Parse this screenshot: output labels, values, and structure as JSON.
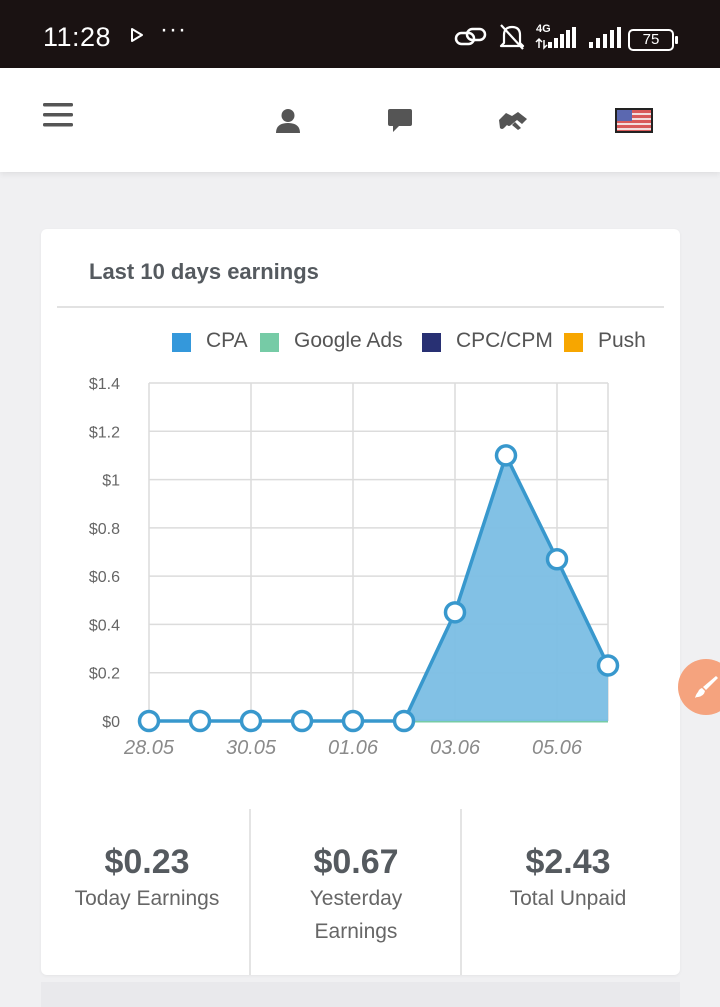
{
  "status_bar": {
    "time": "11:28",
    "network": "4G",
    "battery": "75"
  },
  "nav": {
    "icons": [
      "menu-icon",
      "user-icon",
      "chat-icon",
      "handshake-icon",
      "us-flag-icon"
    ]
  },
  "card": {
    "title": "Last 10 days earnings"
  },
  "chart_data": {
    "type": "area",
    "title": "Last 10 days earnings",
    "legend_position": "top-right",
    "grid": true,
    "x_dates": [
      "28.05",
      "29.05",
      "30.05",
      "31.05",
      "01.06",
      "02.06",
      "03.06",
      "04.06",
      "05.06",
      "06.06"
    ],
    "x_tick_labels": [
      "28.05",
      "30.05",
      "01.06",
      "03.06",
      "05.06"
    ],
    "y_tick_labels": [
      "$0",
      "$0.2",
      "$0.4",
      "$0.6",
      "$0.8",
      "$1",
      "$1.2",
      "$1.4"
    ],
    "ylim": [
      0,
      1.4
    ],
    "series": [
      {
        "name": "CPA",
        "color": "#3498db",
        "values": [
          0,
          0,
          0,
          0,
          0,
          0,
          0.45,
          1.1,
          0.67,
          0.23
        ]
      },
      {
        "name": "Google Ads",
        "color": "#76cba6",
        "values": [
          0,
          0,
          0,
          0,
          0,
          0,
          0,
          0,
          0,
          0
        ]
      },
      {
        "name": "CPC/CPM",
        "color": "#283073",
        "values": []
      },
      {
        "name": "Push",
        "color": "#f7a600",
        "values": []
      }
    ]
  },
  "stats": [
    {
      "value": "$0.23",
      "label": "Today Earnings"
    },
    {
      "value": "$0.67",
      "label": "Yesterday Earnings"
    },
    {
      "value": "$2.43",
      "label": "Total Unpaid"
    }
  ],
  "colors": {
    "accent_fab": "#f5a37e",
    "area_fill": "#7bbee4",
    "line": "#3898cd"
  }
}
